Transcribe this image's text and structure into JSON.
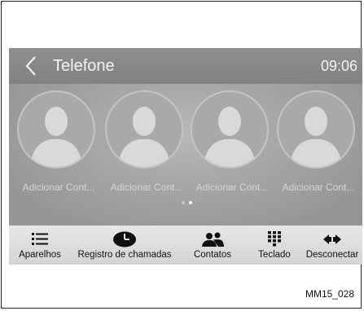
{
  "screen": {
    "title": "Telefone",
    "clock": "09:06"
  },
  "contacts": [
    {
      "label": "Adicionar Cont..."
    },
    {
      "label": "Adicionar Cont..."
    },
    {
      "label": "Adicionar Cont..."
    },
    {
      "label": "Adicionar Cont..."
    }
  ],
  "pager": {
    "pages": 2,
    "active": 2
  },
  "toolbar": {
    "aparelhos": "Aparelhos",
    "registro": "Registro de chamadas",
    "contatos": "Contatos",
    "teclado": "Teclado",
    "desconectar": "Desconectar"
  },
  "icons": {
    "back": "chevron-left-icon",
    "avatar": "person-silhouette-icon",
    "aparelhos": "list-icon",
    "registro": "clock-icon",
    "contatos": "people-icon",
    "teclado": "keypad-icon",
    "desconectar": "disconnect-icon"
  },
  "caption": "MM15_028"
}
